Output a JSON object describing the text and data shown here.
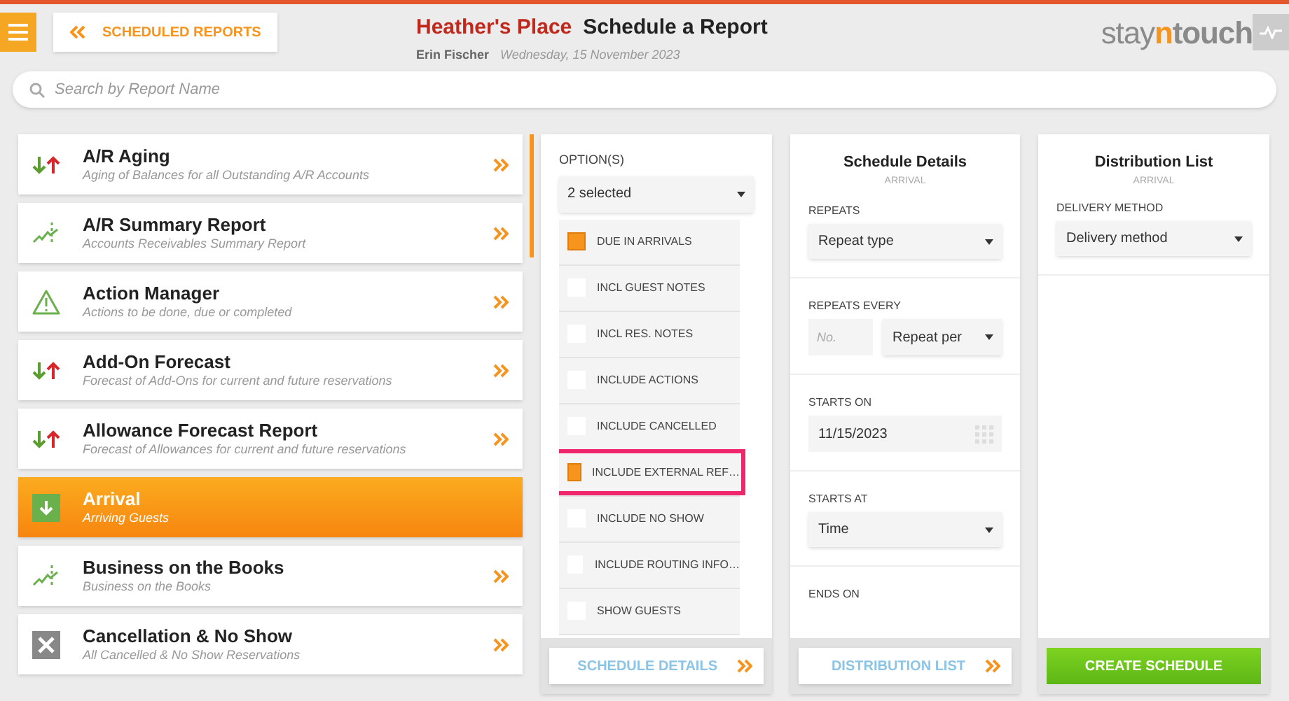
{
  "header": {
    "back_label": "SCHEDULED REPORTS",
    "hotel": "Heather's Place",
    "title": "Schedule a Report",
    "user": "Erin Fischer",
    "date": "Wednesday, 15 November 2023",
    "logo_a": "stay",
    "logo_b": "n",
    "logo_c": "touch"
  },
  "search": {
    "placeholder": "Search by Report Name"
  },
  "reports": [
    {
      "kind": "arrows",
      "name": "A/R Aging",
      "description": "Aging of Balances for all Outstanding A/R Accounts",
      "selected": false
    },
    {
      "kind": "chart",
      "name": "A/R Summary Report",
      "description": "Accounts Receivables Summary Report",
      "selected": false
    },
    {
      "kind": "warning",
      "name": "Action Manager",
      "description": "Actions to be done, due or completed",
      "selected": false
    },
    {
      "kind": "arrows",
      "name": "Add-On Forecast",
      "description": "Forecast of Add-Ons for current and future reservations",
      "selected": false
    },
    {
      "kind": "arrows",
      "name": "Allowance Forecast Report",
      "description": "Forecast of Allowances for current and future reservations",
      "selected": false
    },
    {
      "kind": "arrival",
      "name": "Arrival",
      "description": "Arriving Guests",
      "selected": true
    },
    {
      "kind": "chart",
      "name": "Business on the Books",
      "description": "Business on the Books",
      "selected": false
    },
    {
      "kind": "cancel",
      "name": "Cancellation & No Show",
      "description": "All Cancelled & No Show Reservations",
      "selected": false
    }
  ],
  "options": {
    "label": "OPTION(S)",
    "value": "2 selected",
    "items": [
      {
        "label": "DUE IN ARRIVALS",
        "checked": true,
        "highlighted": false
      },
      {
        "label": "INCL GUEST NOTES",
        "checked": false,
        "highlighted": false
      },
      {
        "label": "INCL RES. NOTES",
        "checked": false,
        "highlighted": false
      },
      {
        "label": "INCLUDE ACTIONS",
        "checked": false,
        "highlighted": false
      },
      {
        "label": "INCLUDE CANCELLED",
        "checked": false,
        "highlighted": false
      },
      {
        "label": "INCLUDE EXTERNAL REF…",
        "checked": true,
        "highlighted": true
      },
      {
        "label": "INCLUDE NO SHOW",
        "checked": false,
        "highlighted": false
      },
      {
        "label": "INCLUDE ROUTING INFO…",
        "checked": false,
        "highlighted": false
      },
      {
        "label": "SHOW GUESTS",
        "checked": false,
        "highlighted": false
      }
    ],
    "button": "SCHEDULE DETAILS"
  },
  "schedule": {
    "title": "Schedule Details",
    "subtitle": "ARRIVAL",
    "repeats_label": "REPEATS",
    "repeats_value": "Repeat type",
    "every_label": "REPEATS EVERY",
    "every_placeholder": "No.",
    "every_value": "Repeat per",
    "starts_on_label": "STARTS ON",
    "starts_on_value": "11/15/2023",
    "starts_at_label": "STARTS AT",
    "starts_at_value": "Time",
    "ends_on_label": "ENDS ON",
    "button": "DISTRIBUTION LIST"
  },
  "distribution": {
    "title": "Distribution List",
    "subtitle": "ARRIVAL",
    "method_label": "DELIVERY METHOD",
    "method_value": "Delivery method",
    "button": "CREATE SCHEDULE"
  }
}
